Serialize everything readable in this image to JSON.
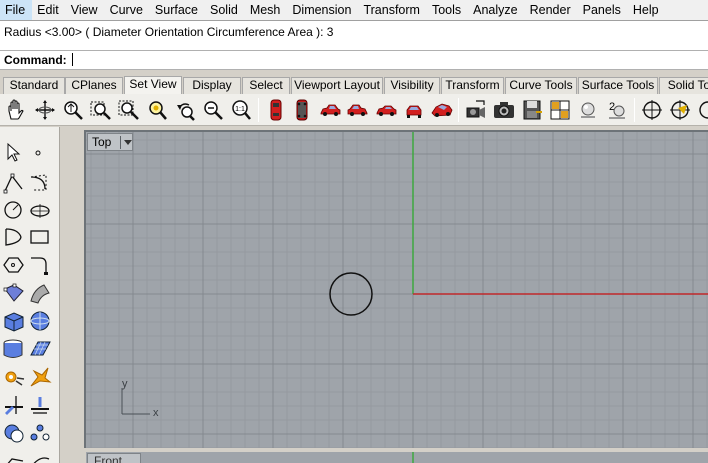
{
  "menu": [
    "File",
    "Edit",
    "View",
    "Curve",
    "Surface",
    "Solid",
    "Mesh",
    "Dimension",
    "Transform",
    "Tools",
    "Analyze",
    "Render",
    "Panels",
    "Help"
  ],
  "command": {
    "history": "Radius <3.00> ( Diameter  Orientation  Circumference  Area ): 3",
    "label": "Command:"
  },
  "tabs": [
    "Standard",
    "CPlanes",
    "Set View",
    "Display",
    "Select",
    "Viewport Layout",
    "Visibility",
    "Transform",
    "Curve Tools",
    "Surface Tools",
    "Solid To"
  ],
  "active_tab": "Set View",
  "toolbar_icons": [
    "pan-icon",
    "rotate-view-icon",
    "zoom-dynamic-icon",
    "zoom-window-icon",
    "zoom-extents-icon",
    "zoom-selected-icon",
    "undo-view-icon",
    "zoom-out-icon",
    "zoom-one-to-one-icon",
    "view-top-icon",
    "view-bottom-icon",
    "view-left-car-icon",
    "view-right-car-icon",
    "view-front-car-icon",
    "view-back-car-icon",
    "view-perspective-car-icon",
    "camera-set-icon",
    "camera-icon",
    "save-view-icon",
    "restore-view-icon",
    "light-icon",
    "two-point-perspective-icon",
    "target-icon",
    "target-set-icon"
  ],
  "palette_icons": [
    "select-arrow-icon",
    "point-icon",
    "polyline-icon",
    "curve-control-points-icon",
    "circle-icon",
    "ellipse-icon",
    "arc-icon",
    "rectangle-icon",
    "polygon-icon",
    "fillet-curve-icon",
    "surface-points-icon",
    "surface-edge-icon",
    "box-icon",
    "sphere-icon",
    "cylinder-mesh-icon",
    "plane-mesh-icon",
    "gear-transform-icon",
    "explode-icon",
    "trim-icon",
    "split-icon",
    "boolean-icon",
    "point-cloud-icon",
    "array-icon",
    "pipe-icon"
  ],
  "viewport": {
    "name": "Top",
    "axis_x_label": "x",
    "axis_y_label": "y",
    "grid_color": "#9fa4aa",
    "x_axis_color": "#c0282a",
    "y_axis_color": "#3fa83f",
    "circle_radius": 3
  },
  "viewport2": {
    "name": "Front"
  }
}
